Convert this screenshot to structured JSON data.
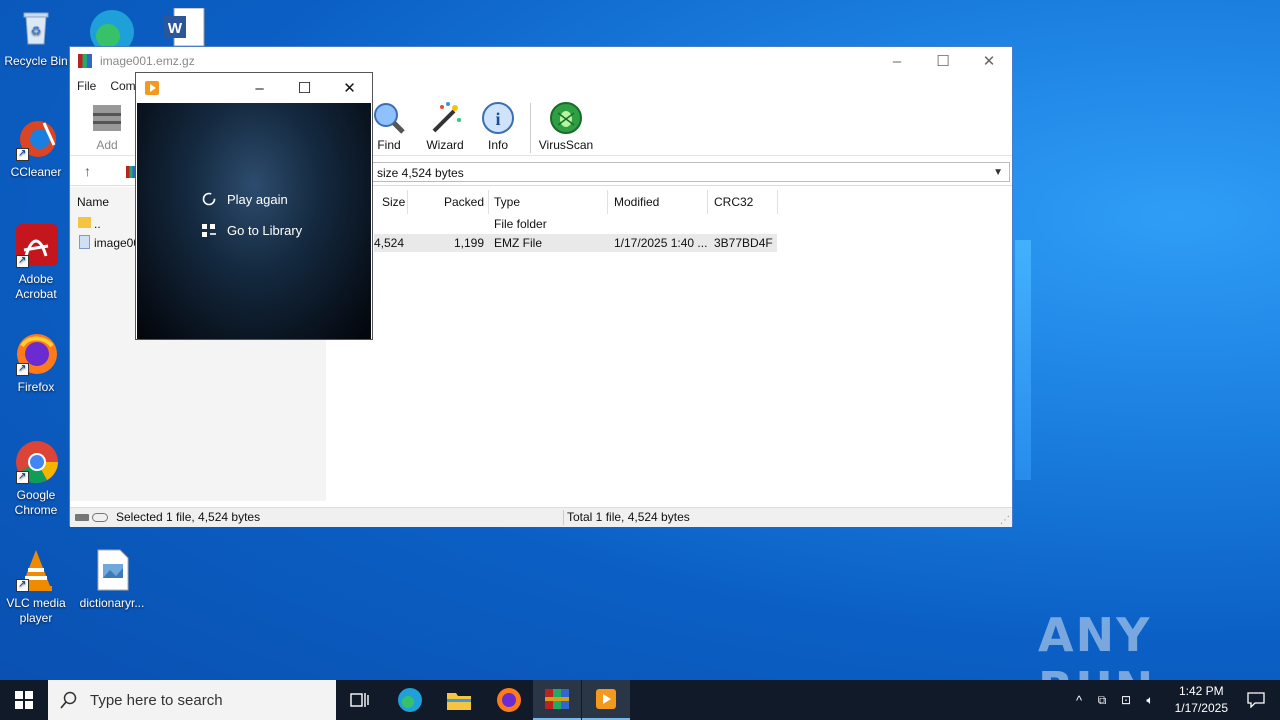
{
  "desktop": {
    "icons": [
      {
        "label": "Recycle Bin"
      },
      {
        "label": "CCleaner"
      },
      {
        "label": "Adobe Acrobat"
      },
      {
        "label": "Firefox"
      },
      {
        "label": "Google Chrome"
      },
      {
        "label": "VLC media player"
      },
      {
        "label": "dictionaryr..."
      }
    ],
    "watermark": "ANY RUN"
  },
  "winrar": {
    "title": "image001.emz.gz",
    "menu": [
      "File",
      "Com"
    ],
    "toolbar": {
      "add": "Add",
      "find": "Find",
      "wizard": "Wizard",
      "info": "Info",
      "virusscan": "VirusScan"
    },
    "path_text": "size 4,524 bytes",
    "columns": {
      "name": "Name",
      "size": "Size",
      "packed": "Packed",
      "type": "Type",
      "modified": "Modified",
      "crc": "CRC32"
    },
    "rows": [
      {
        "name": "..",
        "size": "",
        "packed": "",
        "type": "File folder",
        "modified": "",
        "crc": ""
      },
      {
        "name": "image00",
        "size": "4,524",
        "packed": "1,199",
        "type": "EMZ File",
        "modified": "1/17/2025 1:40 ...",
        "crc": "3B77BD4F"
      }
    ],
    "status_left": "Selected 1 file, 4,524 bytes",
    "status_right": "Total 1 file, 4,524 bytes"
  },
  "player": {
    "play_again": "Play again",
    "go_to_library": "Go to Library"
  },
  "taskbar": {
    "search_placeholder": "Type here to search",
    "time": "1:42 PM",
    "date": "1/17/2025"
  }
}
